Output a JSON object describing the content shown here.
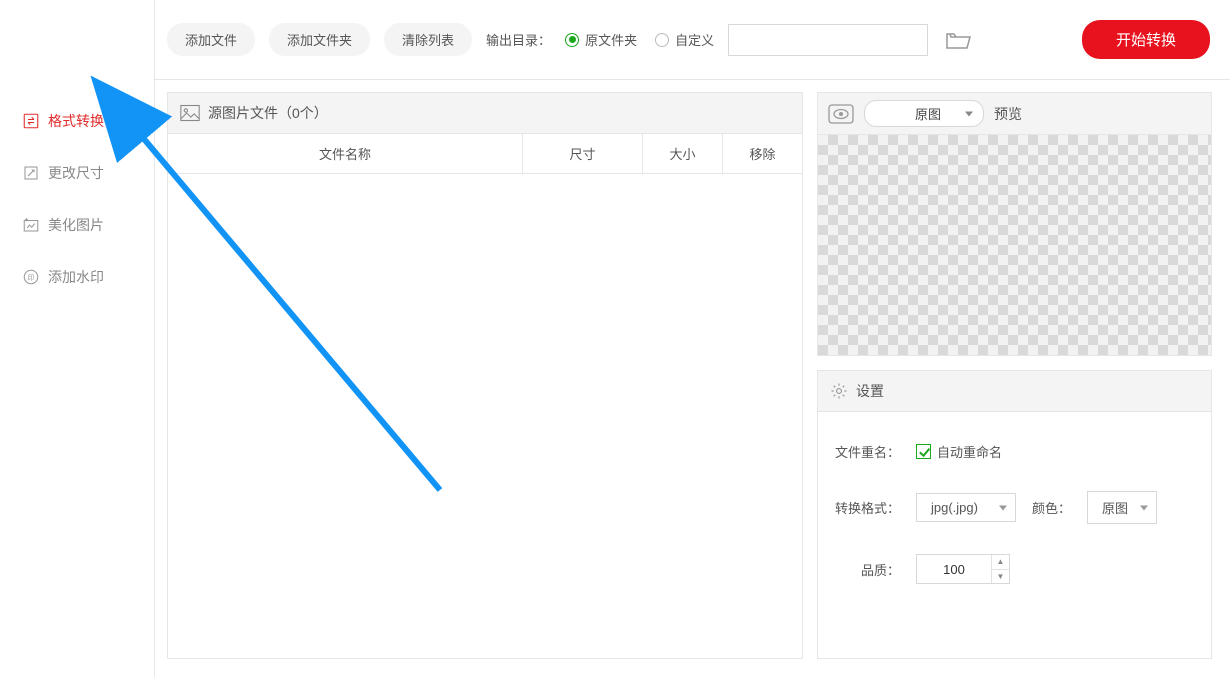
{
  "sidebar": {
    "items": [
      {
        "label": "格式转换"
      },
      {
        "label": "更改尺寸"
      },
      {
        "label": "美化图片"
      },
      {
        "label": "添加水印"
      }
    ]
  },
  "toolbar": {
    "add_file": "添加文件",
    "add_folder": "添加文件夹",
    "clear_list": "清除列表",
    "output_dir_label": "输出目录：",
    "radio_original": "原文件夹",
    "radio_custom": "自定义",
    "path_value": "",
    "start": "开始转换"
  },
  "files": {
    "header_title": "源图片文件（0个）",
    "col_name": "文件名称",
    "col_dim": "尺寸",
    "col_size": "大小",
    "col_remove": "移除"
  },
  "preview": {
    "scale_selected": "原图",
    "label": "预览"
  },
  "settings": {
    "title": "设置",
    "rename_label": "文件重名：",
    "rename_checkbox": "自动重命名",
    "format_label": "转换格式：",
    "format_value": "jpg(.jpg)",
    "color_label": "颜色：",
    "color_value": "原图",
    "quality_label": "品质：",
    "quality_value": "100"
  }
}
